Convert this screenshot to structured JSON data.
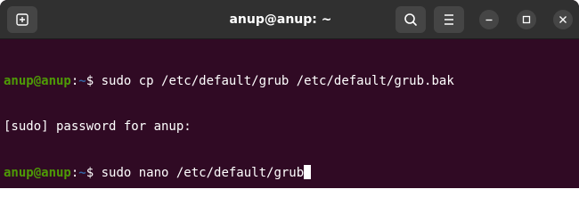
{
  "window": {
    "title": "anup@anup: ~"
  },
  "toolbar": {
    "new_tab_icon": "new-tab-icon",
    "search_icon": "search-icon",
    "menu_icon": "hamburger-menu-icon",
    "minimize_icon": "minimize-icon",
    "maximize_icon": "maximize-icon",
    "close_icon": "close-icon"
  },
  "terminal": {
    "lines": [
      {
        "user_host": "anup@anup",
        "sep": ":",
        "path": "~",
        "symbol": "$ ",
        "command": "sudo cp /etc/default/grub /etc/default/grub.bak"
      },
      {
        "output": "[sudo] password for anup:"
      },
      {
        "user_host": "anup@anup",
        "sep": ":",
        "path": "~",
        "symbol": "$ ",
        "command": "sudo nano /etc/default/grub"
      }
    ]
  },
  "colors": {
    "terminal_background": "#300a24",
    "titlebar_background": "#303030",
    "prompt_user": "#4e9a06",
    "prompt_path": "#3465a4",
    "text": "#ffffff"
  }
}
